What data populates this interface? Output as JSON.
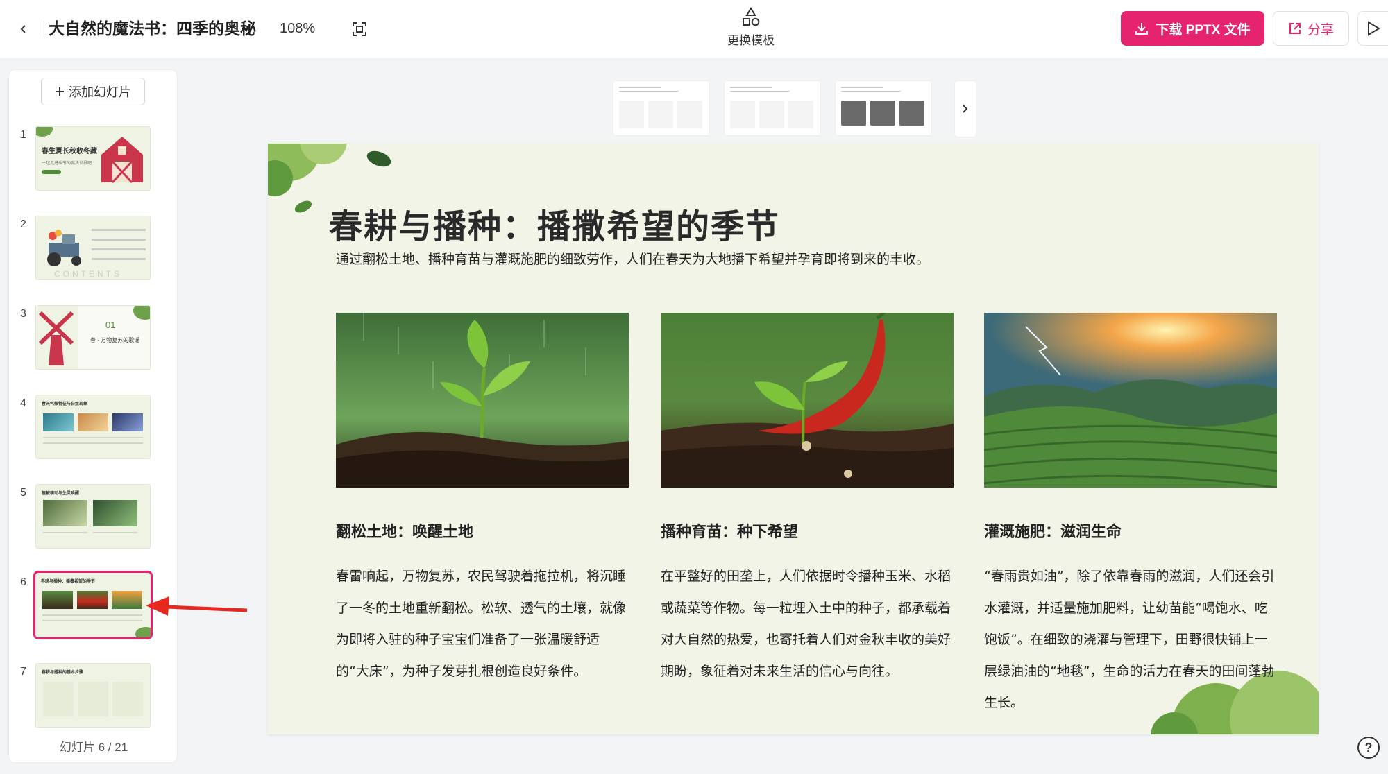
{
  "header": {
    "title": "大自然的魔法书：四季的奥秘",
    "zoom": "108%",
    "template_label": "更换模板",
    "download_label": "下载 PPTX 文件",
    "share_label": "分享"
  },
  "sidebar": {
    "add_slide_label": "添加幻灯片",
    "counter": "幻灯片 6 / 21",
    "active_index": 6,
    "thumbnails": [
      {
        "num": "1",
        "title": "春生夏长秋收冬藏",
        "extra": "一起走进季节的魔法世界吧"
      },
      {
        "num": "2",
        "title": "",
        "extra": "CONTENTS"
      },
      {
        "num": "3",
        "title": "春 · 万物复苏的歌谣",
        "extra": "01"
      },
      {
        "num": "4",
        "title": "春天气候特征与自然现象",
        "extra": ""
      },
      {
        "num": "5",
        "title": "植被萌动与生灵唤醒",
        "extra": ""
      },
      {
        "num": "6",
        "title": "春耕与播种：播撒希望的季节",
        "extra": ""
      },
      {
        "num": "7",
        "title": "春耕与播种的基本步骤",
        "extra": ""
      }
    ]
  },
  "slide": {
    "title": "春耕与播种：播撒希望的季节",
    "subtitle": "通过翻松土地、播种育苗与灌溉施肥的细致劳作，人们在春天为大地播下希望并孕育即将到来的丰收。",
    "columns": [
      {
        "heading": "翻松土地：唤醒土地",
        "body": "春雷响起，万物复苏，农民驾驶着拖拉机，将沉睡了一冬的土地重新翻松。松软、透气的土壤，就像为即将入驻的种子宝宝们准备了一张温暖舒适的“大床”，为种子发芽扎根创造良好条件。"
      },
      {
        "heading": "播种育苗：种下希望",
        "body": "在平整好的田垄上，人们依据时令播种玉米、水稻或蔬菜等作物。每一粒埋入土中的种子，都承载着对大自然的热爱，也寄托着人们对金秋丰收的美好期盼，象征着对未来生活的信心与向往。"
      },
      {
        "heading": "灌溉施肥：滋润生命",
        "body": "“春雨贵如油”，除了依靠春雨的滋润，人们还会引水灌溉，并适量施加肥料，让幼苗能“喝饱水、吃饱饭”。在细致的浇灌与管理下，田野很快铺上一层绿油油的“地毯”，生命的活力在春天的田间蓬勃生长。"
      }
    ]
  },
  "colors": {
    "accent": "#e6236f",
    "slide_bg": "#f1f4e6",
    "leaf_green": "#6fa04a"
  },
  "icons": [
    "chevron-left-icon",
    "fit-screen-icon",
    "shapes-icon",
    "download-icon",
    "share-icon",
    "play-icon",
    "plus-icon",
    "chevron-right-icon",
    "help-icon"
  ]
}
